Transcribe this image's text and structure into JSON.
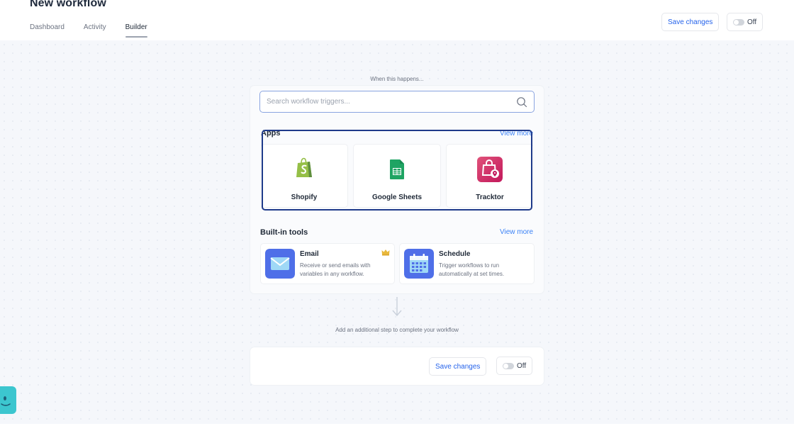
{
  "header": {
    "title": "New workflow",
    "tabs": [
      {
        "label": "Dashboard",
        "active": false
      },
      {
        "label": "Activity",
        "active": false
      },
      {
        "label": "Builder",
        "active": true
      }
    ],
    "save_label": "Save changes",
    "toggle_label": "Off"
  },
  "builder": {
    "when_label": "When this happens...",
    "search": {
      "placeholder": "Search workflow triggers...",
      "value": ""
    },
    "apps": {
      "title": "Apps",
      "view_more": "View more",
      "items": [
        {
          "label": "Shopify",
          "icon": "shopify-icon",
          "color": "#95bf47"
        },
        {
          "label": "Google Sheets",
          "icon": "google-sheets-icon",
          "color": "#1fa463"
        },
        {
          "label": "Tracktor",
          "icon": "tracktor-icon",
          "color": "#d6336c"
        }
      ]
    },
    "tools": {
      "title": "Built-in tools",
      "view_more": "View more",
      "items": [
        {
          "title": "Email",
          "desc": "Receive or send emails with variables in any workflow.",
          "icon": "email-icon",
          "premium": true
        },
        {
          "title": "Schedule",
          "desc": "Trigger workflows to run automatically at set times.",
          "icon": "calendar-icon",
          "premium": false
        }
      ]
    },
    "add_step_text": "Add an additional step to complete your workflow",
    "bottom": {
      "save_label": "Save changes",
      "toggle_label": "Off"
    }
  },
  "colors": {
    "accent": "#3b82f6",
    "highlight": "#1e3a8a",
    "canvas_bg": "#f5f7fb",
    "tool_icon_bg": "#4f6fe8",
    "chat_widget": "#3cc6cf"
  }
}
